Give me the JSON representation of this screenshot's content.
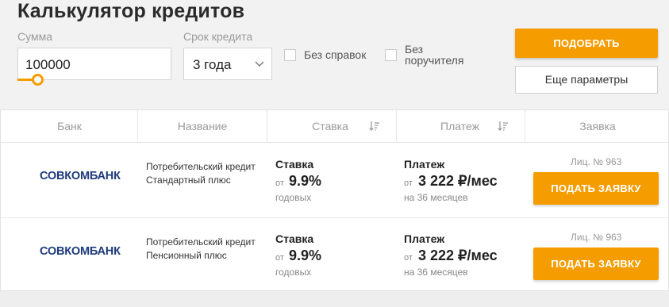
{
  "title": "Калькулятор кредитов",
  "filters": {
    "amount_label": "Сумма",
    "amount_value": "100000",
    "term_label": "Срок кредита",
    "term_value": "3 года",
    "no_certificates_label": "Без справок",
    "no_guarantor_label_line1": "Без",
    "no_guarantor_label_line2": "поручителя",
    "pick_button": "ПОДОБРАТЬ",
    "more_params_button": "Еще параметры"
  },
  "table": {
    "headers": {
      "bank": "Банк",
      "name": "Название",
      "rate": "Ставка",
      "payment": "Платеж",
      "application": "Заявка"
    },
    "rows": [
      {
        "bank_logo_text": "СОВКОМБАНК",
        "product_name": "Потребительский кредит Стандартный плюс",
        "rate_title": "Ставка",
        "rate_from": "от",
        "rate_value": "9.9%",
        "rate_period": "годовых",
        "payment_title": "Платеж",
        "payment_from": "от",
        "payment_value": "3 222 ₽/мес",
        "payment_term": "на 36 месяцев",
        "license": "Лиц. № 963",
        "apply_button": "ПОДАТЬ ЗАЯВКУ"
      },
      {
        "bank_logo_text": "СОВКОМБАНК",
        "product_name": "Потребительский кредит Пенсионный плюс",
        "rate_title": "Ставка",
        "rate_from": "от",
        "rate_value": "9.9%",
        "rate_period": "годовых",
        "payment_title": "Платеж",
        "payment_from": "от",
        "payment_value": "3 222 ₽/мес",
        "payment_term": "на 36 месяцев",
        "license": "Лиц. № 963",
        "apply_button": "ПОДАТЬ ЗАЯВКУ"
      }
    ]
  },
  "colors": {
    "accent": "#f59c00",
    "logo_blue": "#1d3a7a",
    "logo_red": "#e3262f"
  }
}
